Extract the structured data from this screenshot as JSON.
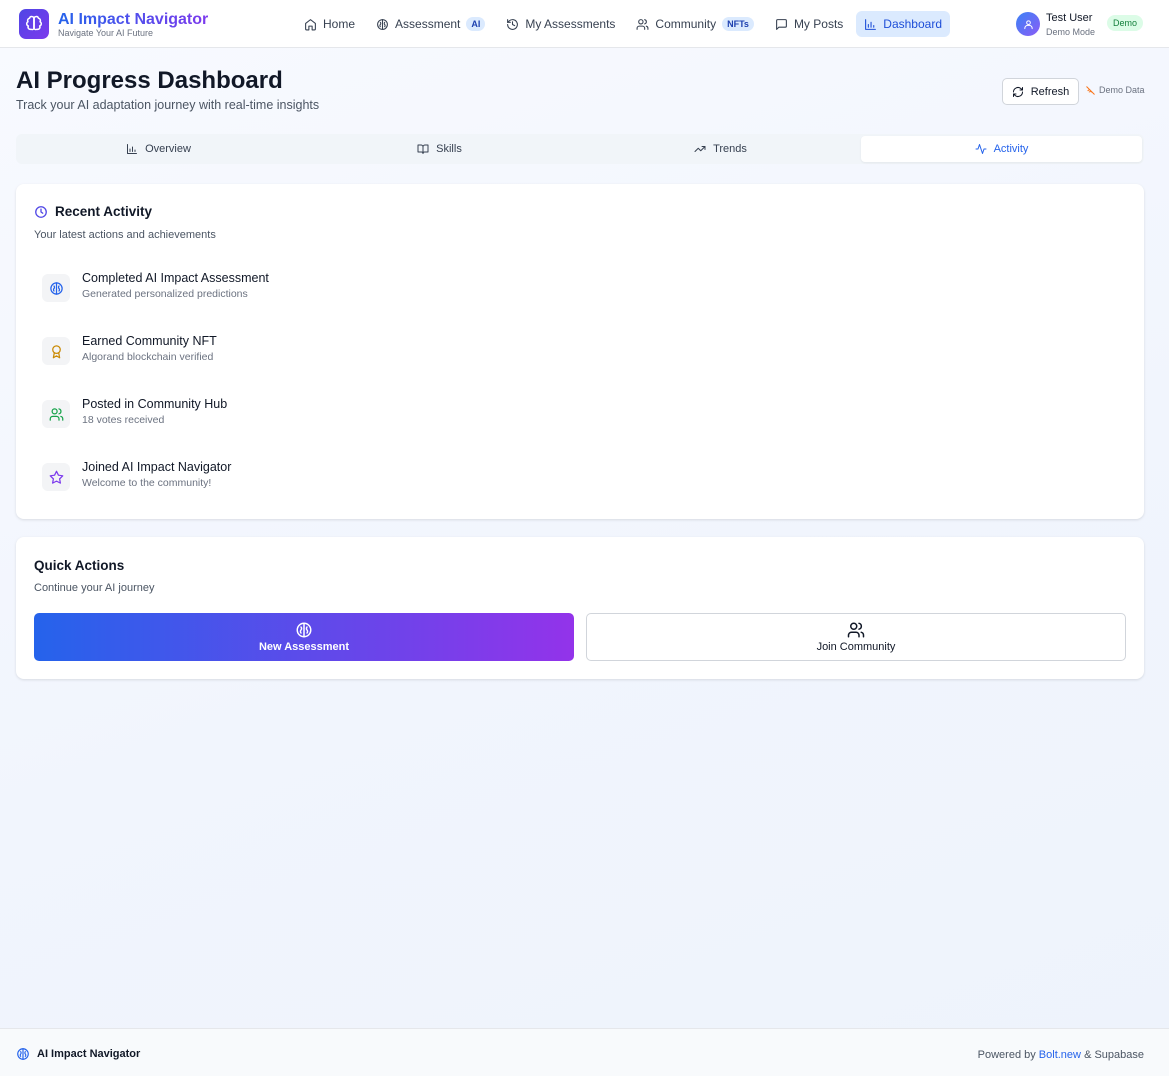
{
  "app": {
    "name": "AI Impact Navigator",
    "tagline": "Navigate Your AI Future"
  },
  "nav": {
    "items": [
      {
        "label": "Home",
        "icon": "home-icon"
      },
      {
        "label": "Assessment",
        "icon": "brain-icon",
        "badge": "AI"
      },
      {
        "label": "My Assessments",
        "icon": "history-icon"
      },
      {
        "label": "Community",
        "icon": "users-icon",
        "badge": "NFTs"
      },
      {
        "label": "My Posts",
        "icon": "message-icon"
      },
      {
        "label": "Dashboard",
        "icon": "bar-chart-icon",
        "active": true
      }
    ]
  },
  "user": {
    "name": "Test User",
    "mode": "Demo Mode",
    "badge": "Demo"
  },
  "page": {
    "title": "AI Progress Dashboard",
    "subtitle": "Track your AI adaptation journey with real-time insights",
    "refresh_label": "Refresh",
    "demo_data_label": "Demo Data"
  },
  "tabs": [
    {
      "label": "Overview",
      "icon": "bar-chart-icon"
    },
    {
      "label": "Skills",
      "icon": "book-icon"
    },
    {
      "label": "Trends",
      "icon": "trending-up-icon"
    },
    {
      "label": "Activity",
      "icon": "activity-icon",
      "active": true
    }
  ],
  "recent_activity": {
    "title": "Recent Activity",
    "description": "Your latest actions and achievements",
    "items": [
      {
        "title": "Completed AI Impact Assessment",
        "description": "Generated personalized predictions",
        "icon": "brain-icon",
        "color": "#2563eb"
      },
      {
        "title": "Earned Community NFT",
        "description": "Algorand blockchain verified",
        "icon": "award-icon",
        "color": "#ca8a04"
      },
      {
        "title": "Posted in Community Hub",
        "description": "18 votes received",
        "icon": "users-icon",
        "color": "#16a34a"
      },
      {
        "title": "Joined AI Impact Navigator",
        "description": "Welcome to the community!",
        "icon": "star-icon",
        "color": "#7c3aed"
      }
    ]
  },
  "quick_actions": {
    "title": "Quick Actions",
    "description": "Continue your AI journey",
    "primary_label": "New Assessment",
    "secondary_label": "Join Community"
  },
  "footer": {
    "brand": "AI Impact Navigator",
    "powered_prefix": "Powered by",
    "powered_link": "Bolt.new",
    "powered_suffix": "& Supabase"
  },
  "colors": {
    "accent": "#2563eb",
    "brand_gradient_start": "#2563eb",
    "brand_gradient_end": "#9333ea"
  }
}
